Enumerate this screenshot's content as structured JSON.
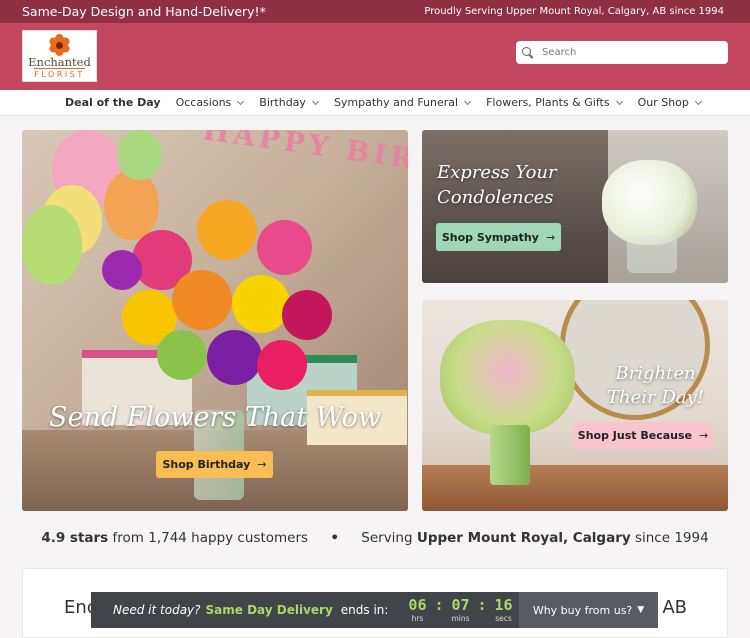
{
  "topbar": {
    "left": "Same-Day Design and Hand-Delivery!*",
    "right": "Proudly Serving Upper Mount Royal, Calgary, AB since 1994"
  },
  "logo": {
    "name": "Enchanted",
    "sub": "FLORIST"
  },
  "search": {
    "placeholder": "Search",
    "icon": "search-icon"
  },
  "nav": {
    "deal": "Deal of the Day",
    "items": [
      "Occasions",
      "Birthday",
      "Sympathy and Funeral",
      "Flowers, Plants & Gifts",
      "Our Shop"
    ]
  },
  "hero": {
    "banner": "HAPPY BIRTH",
    "title": "Send Flowers That Wow",
    "button": "Shop Birthday"
  },
  "sympathy": {
    "title_line1": "Express Your",
    "title_line2": "Condolences",
    "button": "Shop Sympathy"
  },
  "brighten": {
    "title_line1": "Brighten",
    "title_line2": "Their Day!",
    "button": "Shop Just Because"
  },
  "rating": {
    "stars": "4.9 stars",
    "from": "from 1,744 happy customers",
    "bullet": "•",
    "serving": "Serving",
    "location": "Upper Mount Royal, Calgary",
    "since": "since 1994"
  },
  "panel": {
    "text_start": "Enc",
    "text_end": "AB"
  },
  "timer": {
    "need": "Need it today?",
    "sdd": "Same Day Delivery",
    "ends": "ends in:",
    "hrs": "06",
    "mins": "07",
    "secs": "16",
    "hrs_label": "hrs",
    "mins_label": "mins",
    "secs_label": "secs",
    "why": "Why buy from us?"
  },
  "colors": {
    "topbar": "#8e2f44",
    "header": "#c2475f",
    "birthday_button": "#f9bd54",
    "sympathy_button": "#9fd7b8",
    "just_because_button": "#f8c4cf",
    "timer_accent": "#a8d86a"
  }
}
